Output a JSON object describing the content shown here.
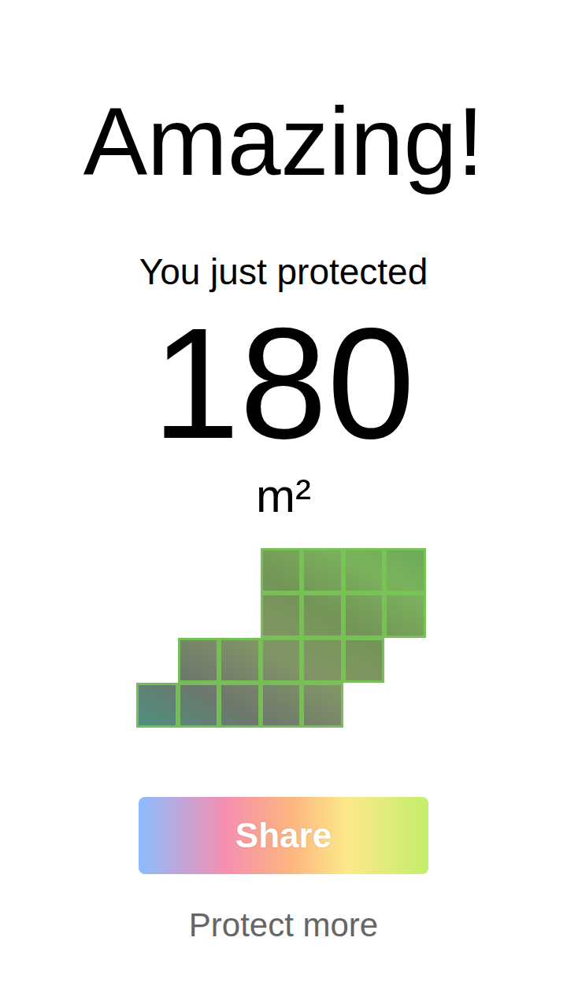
{
  "headline": "Amazing!",
  "subtitle": "You just protected",
  "amount": "180",
  "unit": "m²",
  "area_grid": {
    "rows": [
      [
        false,
        false,
        false,
        true,
        true,
        true,
        true
      ],
      [
        false,
        false,
        false,
        true,
        true,
        true,
        true
      ],
      [
        false,
        true,
        true,
        true,
        true,
        true,
        false
      ],
      [
        true,
        true,
        true,
        true,
        true,
        false,
        false
      ]
    ]
  },
  "share_button": {
    "label": "Share"
  },
  "protect_more_link": {
    "label": "Protect more"
  }
}
